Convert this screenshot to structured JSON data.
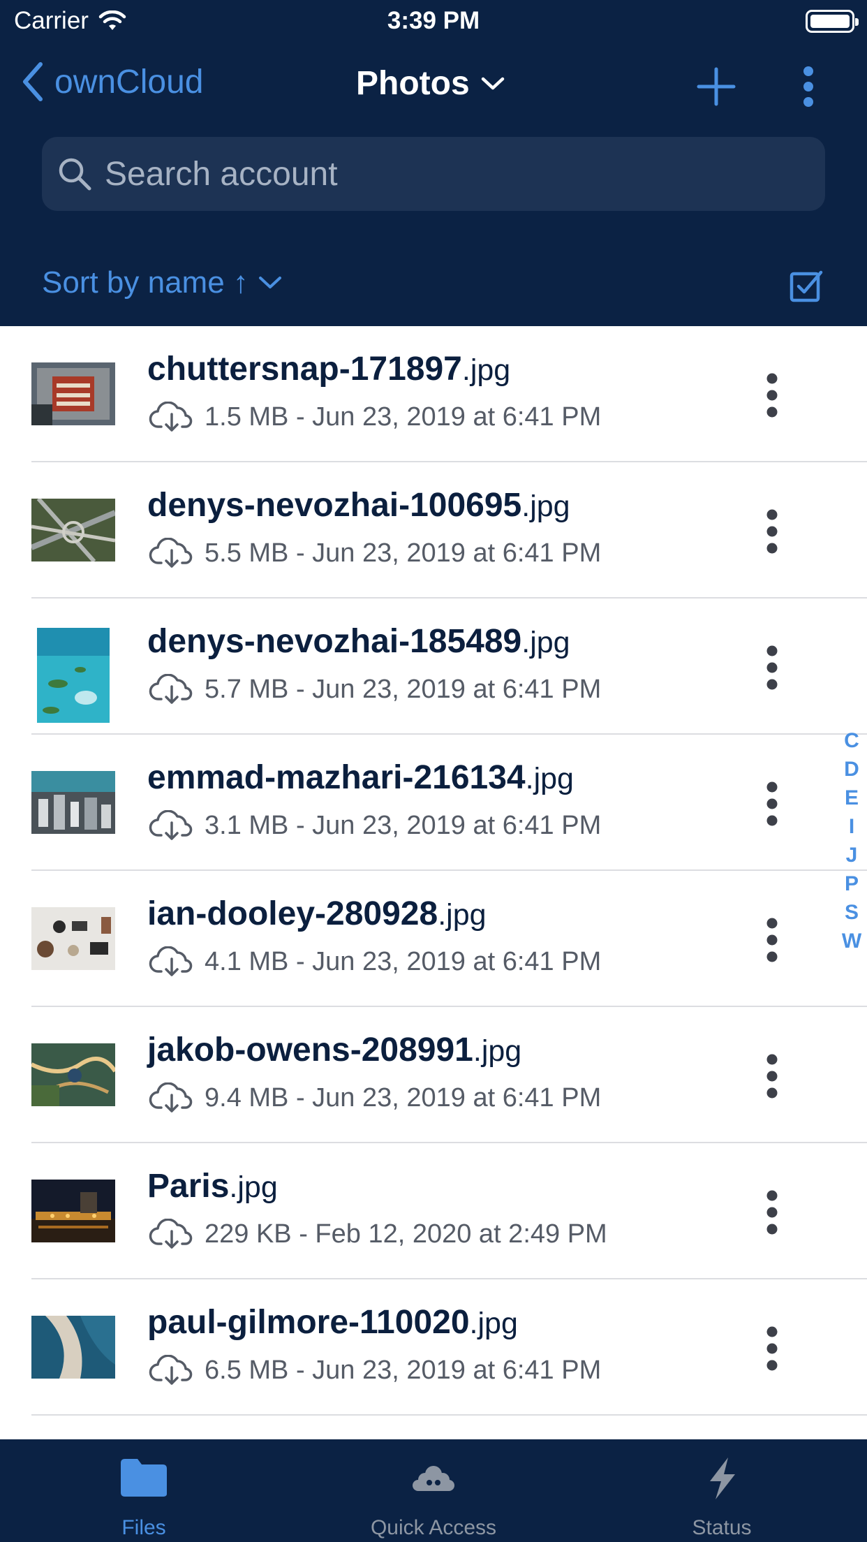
{
  "status_bar": {
    "carrier": "Carrier",
    "time": "3:39 PM"
  },
  "nav": {
    "back_label": "ownCloud",
    "title": "Photos"
  },
  "search": {
    "placeholder": "Search account",
    "value": ""
  },
  "sort": {
    "label": "Sort by name ↑"
  },
  "colors": {
    "header": "#0b2244",
    "accent": "#4a90e2",
    "text": "#0b1f3e",
    "meta": "#555b66"
  },
  "files": [
    {
      "base": "chuttersnap-171897",
      "ext": ".jpg",
      "meta": "1.5 MB - Jun 23, 2019 at 6:41 PM",
      "icon": "cloud-download-icon"
    },
    {
      "base": "denys-nevozhai-100695",
      "ext": ".jpg",
      "meta": "5.5 MB - Jun 23, 2019 at 6:41 PM",
      "icon": "cloud-download-icon"
    },
    {
      "base": "denys-nevozhai-185489",
      "ext": ".jpg",
      "meta": "5.7 MB - Jun 23, 2019 at 6:41 PM",
      "icon": "cloud-download-icon"
    },
    {
      "base": "emmad-mazhari-216134",
      "ext": ".jpg",
      "meta": "3.1 MB - Jun 23, 2019 at 6:41 PM",
      "icon": "cloud-download-icon"
    },
    {
      "base": "ian-dooley-280928",
      "ext": ".jpg",
      "meta": "4.1 MB - Jun 23, 2019 at 6:41 PM",
      "icon": "cloud-download-icon"
    },
    {
      "base": "jakob-owens-208991",
      "ext": ".jpg",
      "meta": "9.4 MB - Jun 23, 2019 at 6:41 PM",
      "icon": "cloud-download-icon"
    },
    {
      "base": "Paris",
      "ext": ".jpg",
      "meta": "229 KB - Feb 12, 2020 at 2:49 PM",
      "icon": "cloud-download-icon"
    },
    {
      "base": "paul-gilmore-110020",
      "ext": ".jpg",
      "meta": "6.5 MB - Jun 23, 2019 at 6:41 PM",
      "icon": "cloud-download-icon"
    }
  ],
  "index_letters": [
    "C",
    "D",
    "E",
    "I",
    "J",
    "P",
    "S",
    "W"
  ],
  "tabs": [
    {
      "label": "Files",
      "icon": "folder-icon",
      "active": true
    },
    {
      "label": "Quick Access",
      "icon": "cloud-group-icon",
      "active": false
    },
    {
      "label": "Status",
      "icon": "bolt-icon",
      "active": false
    }
  ]
}
